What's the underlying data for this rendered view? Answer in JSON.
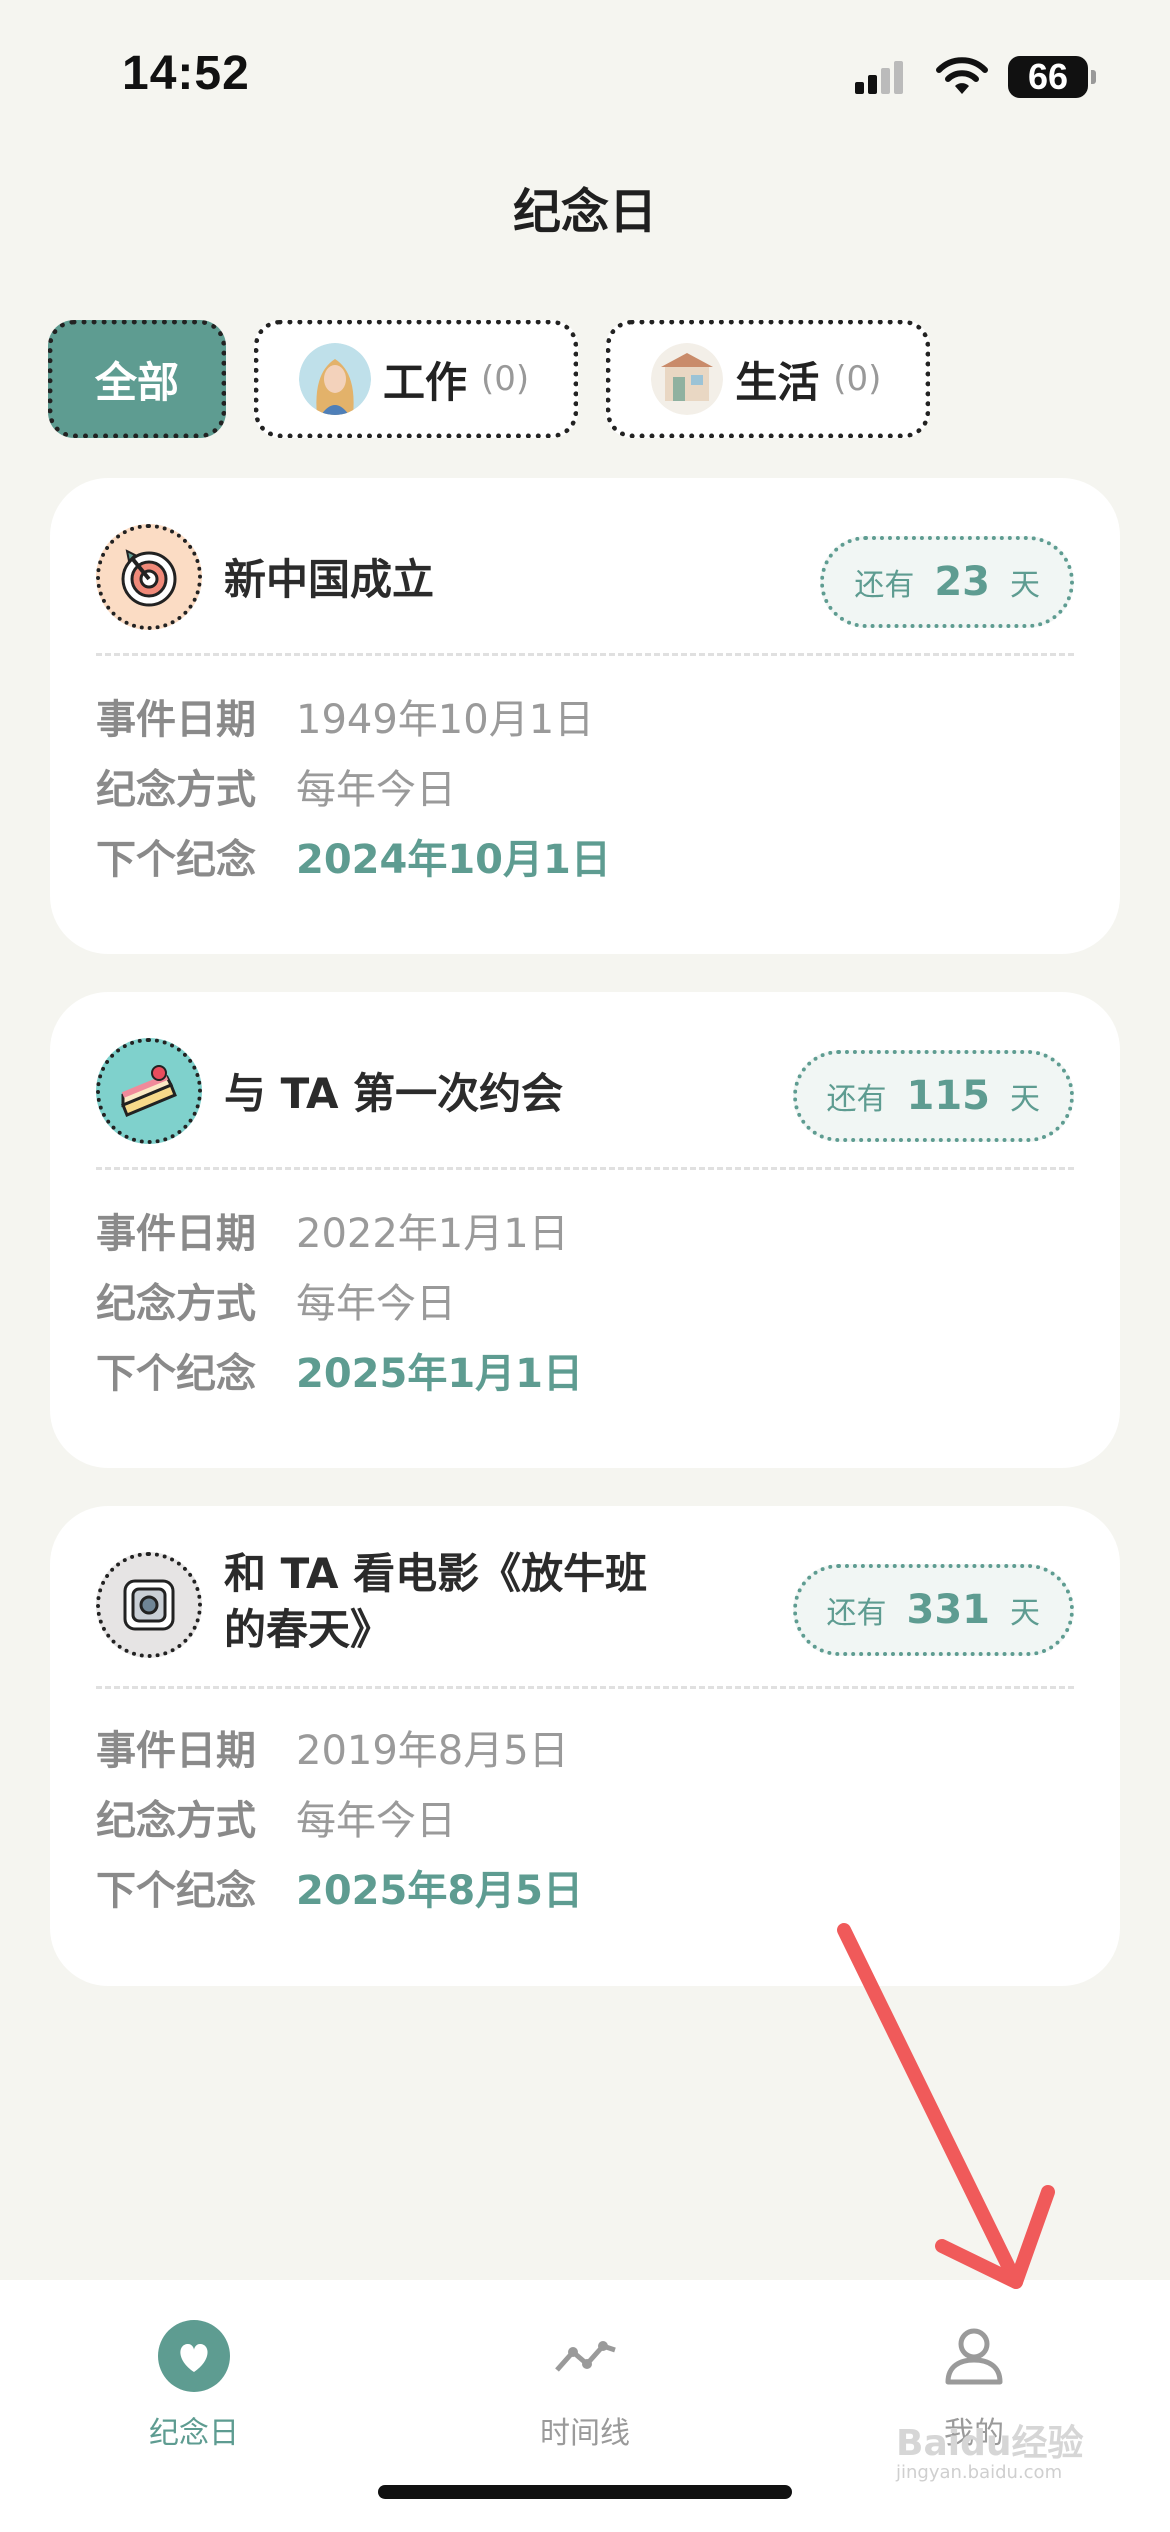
{
  "status_bar": {
    "time": "14:52",
    "battery": "66"
  },
  "header": {
    "title": "纪念日"
  },
  "tabs": [
    {
      "label": "全部"
    },
    {
      "label": "工作",
      "count": "(0)"
    },
    {
      "label": "生活",
      "count": "(0)"
    }
  ],
  "cards": [
    {
      "title": "新中国成立",
      "icon": "target-icon",
      "countdown": {
        "prefix": "还有",
        "days": "23",
        "suffix": "天"
      },
      "rows": [
        {
          "key": "事件日期",
          "value": "1949年10月1日"
        },
        {
          "key": "纪念方式",
          "value": "每年今日"
        },
        {
          "key": "下个纪念",
          "value": "2024年10月1日"
        }
      ]
    },
    {
      "title": "与 TA 第一次约会",
      "icon": "cake-icon",
      "countdown": {
        "prefix": "还有",
        "days": "115",
        "suffix": "天"
      },
      "rows": [
        {
          "key": "事件日期",
          "value": "2022年1月1日"
        },
        {
          "key": "纪念方式",
          "value": "每年今日"
        },
        {
          "key": "下个纪念",
          "value": "2025年1月1日"
        }
      ]
    },
    {
      "title": "和 TA 看电影《放牛班的春天》",
      "icon": "camera-icon",
      "countdown": {
        "prefix": "还有",
        "days": "331",
        "suffix": "天"
      },
      "rows": [
        {
          "key": "事件日期",
          "value": "2019年8月5日"
        },
        {
          "key": "纪念方式",
          "value": "每年今日"
        },
        {
          "key": "下个纪念",
          "value": "2025年8月5日"
        }
      ]
    }
  ],
  "bottom_nav": [
    {
      "label": "纪念日",
      "icon": "heart-icon",
      "active": true
    },
    {
      "label": "时间线",
      "icon": "timeline-icon",
      "active": false
    },
    {
      "label": "我的",
      "icon": "user-icon",
      "active": false
    }
  ],
  "watermark": {
    "brand": "Baidu经验",
    "url": "jingyan.baidu.com"
  },
  "colors": {
    "accent": "#5e9c91",
    "background": "#f5f5f0",
    "arrow": "#f05a5a"
  }
}
